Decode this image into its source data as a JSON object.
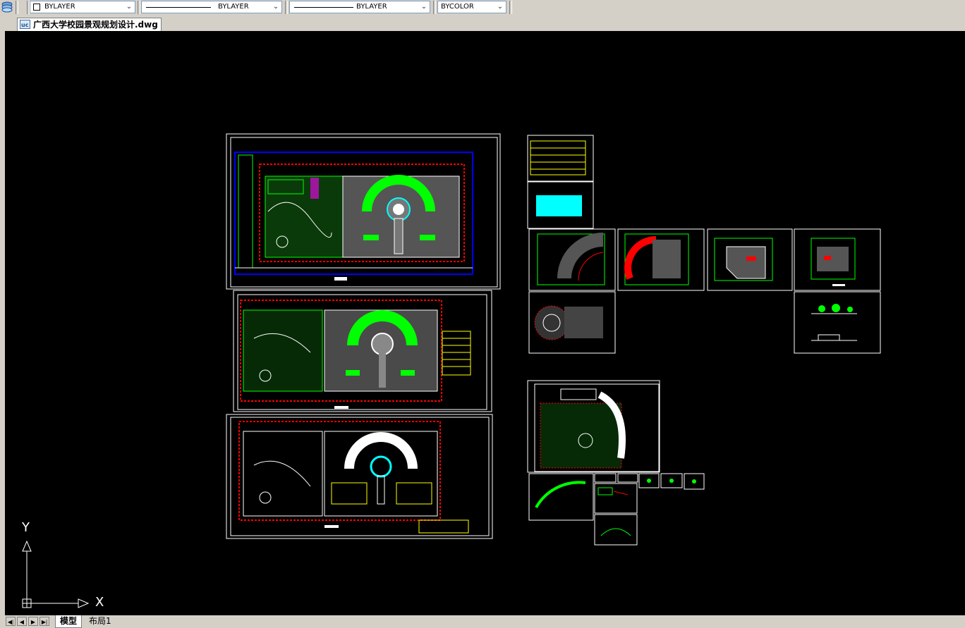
{
  "toolbar": {
    "layer_icon": "layers-icon",
    "color_combo": {
      "value": "BYLAYER"
    },
    "linetype_combo": {
      "value": "BYLAYER"
    },
    "lineweight_combo": {
      "value": "BYLAYER"
    },
    "plotstyle_combo": {
      "value": "BYCOLOR"
    }
  },
  "document_tab": {
    "title": "广西大学校园景观规划设计.dwg",
    "icon": "dwg-file-icon"
  },
  "canvas": {
    "background": "#000000"
  },
  "ucs": {
    "y_label": "Y",
    "x_label": "X"
  },
  "layout_tabs": {
    "nav": [
      "first-tab-icon",
      "prev-tab-icon",
      "next-tab-icon",
      "last-tab-icon"
    ],
    "tabs": [
      {
        "label": "模型",
        "active": true
      },
      {
        "label": "布局1",
        "active": false
      }
    ]
  },
  "colors": {
    "cad_green": "#00ff00",
    "cad_red": "#ff0000",
    "cad_white": "#ffffff",
    "cad_cyan": "#00ffff",
    "cad_yellow": "#ffff00",
    "cad_magenta": "#ff00ff",
    "cad_blue": "#0000ff"
  }
}
